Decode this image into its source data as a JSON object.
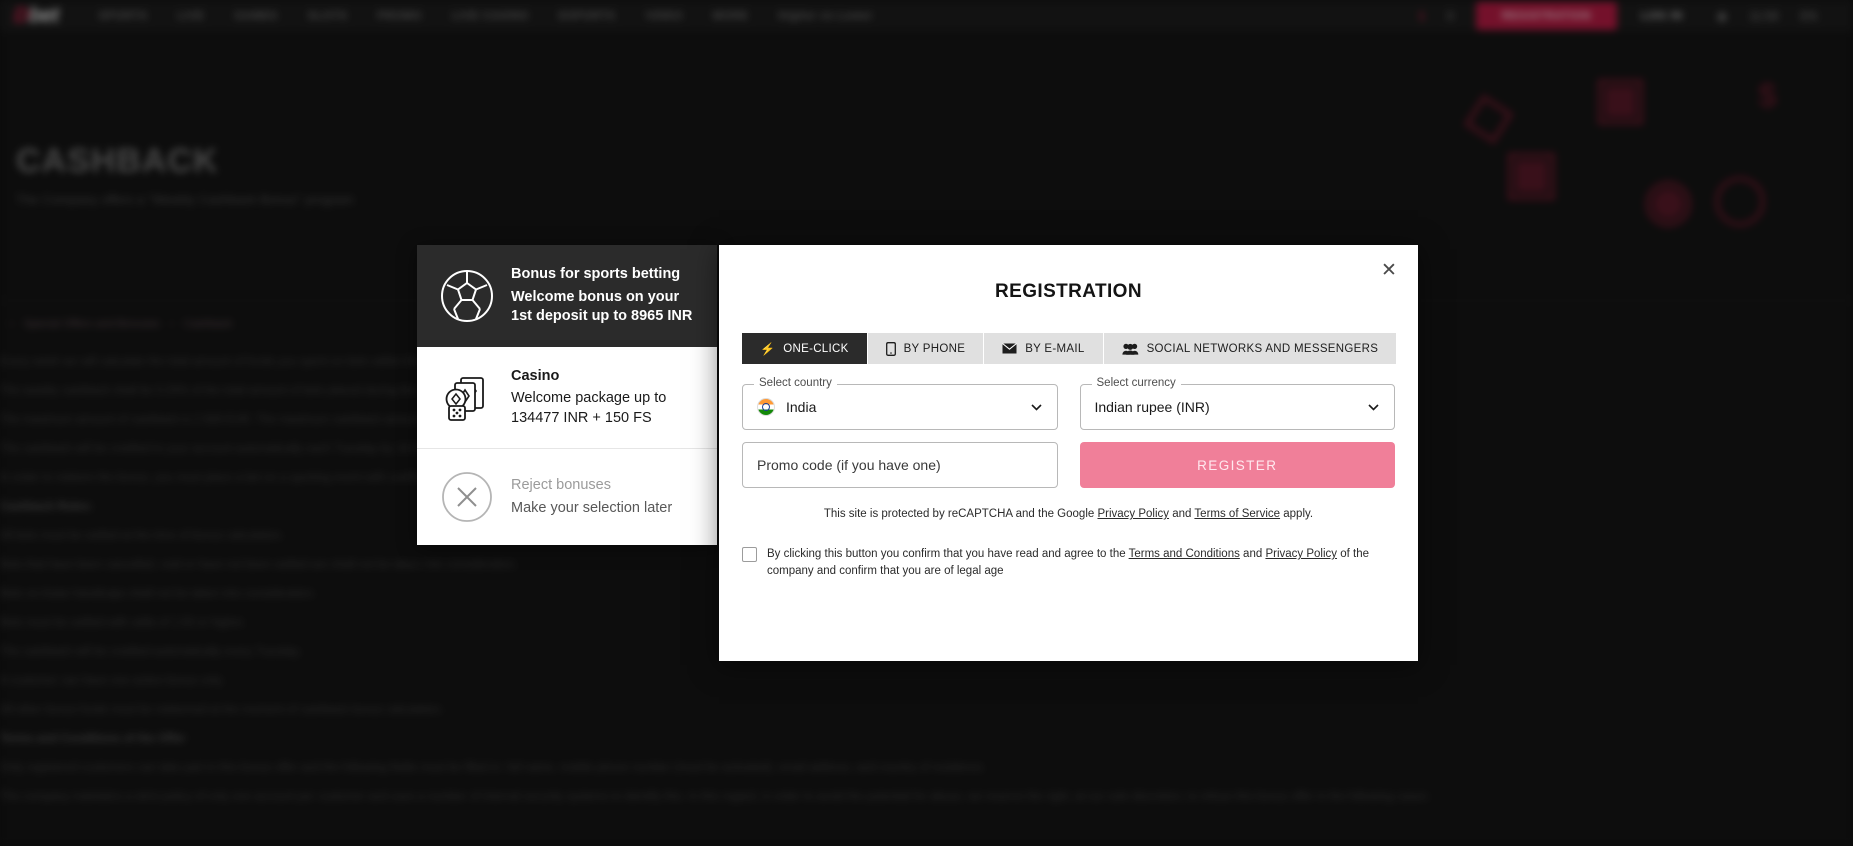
{
  "header": {
    "logo_text": "bet",
    "logo_prefix": "D",
    "nav": [
      {
        "label": "SPORTS"
      },
      {
        "label": "LIVE"
      },
      {
        "label": "GAMES"
      },
      {
        "label": "SLOTS"
      },
      {
        "label": "PROMO"
      },
      {
        "label": "LIVE CASINO"
      },
      {
        "label": "ESPORTS"
      },
      {
        "label": "VIDEO"
      },
      {
        "label": "MORE"
      }
    ],
    "higher_lower_label": "Higher vs Lower",
    "notifications_count": "1",
    "gift_badge": "0",
    "register_label": "REGISTRATION",
    "login_label": "LOG IN",
    "language_label": "EN",
    "time_label": "11:59"
  },
  "hero": {
    "title": "CASHBACK",
    "subtitle": "The Company offers a \"Weekly Cashback Bonus\" program"
  },
  "breadcrumb": {
    "root": "Special Offers and Bonuses",
    "current": "Cashback"
  },
  "page_body": {
    "lines": [
      "Every week we will calculate the total amount of funds you spent on bets within the calendar week.",
      "The weekly cashback shall be 0.25% of the total amount of bets placed during the week.",
      "The maximum amount of cashback is 2 928 EUR. The maximum cashback amount depends on your status.",
      "The cashback will be credited to your account automatically each Tuesday by 18:00 (GMT+3).",
      "In order to redeem the bonus, you must place a bet on a sporting event with coefficients not lower than 1.50.",
      "Cashback Rules:",
      "All bets must be settled at the time of bonus calculation.",
      "Bets that have been cancelled, void or have not been settled are shall not be taken into consideration.",
      "Bets on Asian handicaps shall not be taken into consideration.",
      "Bets must be settled with odds of 1.50 or higher.",
      "The cashback will be credited automatically every Tuesday.",
      "A customer can have one active bonus only.",
      "All other bonus funds must be redeemed at the moment of cashback bonus calculation.",
      "Terms and Conditions of the Offer",
      "Only registered customers can take part in this bonus offer and the following fields must be filled in: full name, mobile phone number (must be activated), email address, and country of residence.",
      "The company maintains a strict policy of only one account per customer and uses a number of internal security systems to identify this. In this regard, in order to avoid the potential for abuse, we reserve the right, at our sole discretion, to refuse this bonus offer in the following cases:"
    ]
  },
  "bonus_panel": {
    "options": [
      {
        "icon": "football-icon",
        "title": "Bonus for sports betting",
        "description": "Welcome bonus on your 1st deposit up to 8965 INR",
        "selected": true
      },
      {
        "icon": "casino-chips-icon",
        "title": "Casino",
        "description": "Welcome package up to 134477 INR + 150 FS",
        "selected": false
      },
      {
        "icon": "reject-circle-x-icon",
        "title": "Reject bonuses",
        "description": "Make your selection later",
        "selected": false
      }
    ]
  },
  "modal": {
    "title": "REGISTRATION",
    "close_label": "✕",
    "tabs": [
      {
        "label": "ONE-CLICK",
        "icon": "lightning-icon",
        "active": true
      },
      {
        "label": "BY PHONE",
        "icon": "phone-icon",
        "active": false
      },
      {
        "label": "BY E-MAIL",
        "icon": "envelope-icon",
        "active": false
      },
      {
        "label": "SOCIAL NETWORKS AND MESSENGERS",
        "icon": "people-icon",
        "active": false
      }
    ],
    "country": {
      "legend": "Select country",
      "value": "India",
      "flag": "india-flag-icon"
    },
    "currency": {
      "legend": "Select currency",
      "value": "Indian rupee (INR)"
    },
    "promo": {
      "placeholder": "Promo code (if you have one)",
      "value": ""
    },
    "register_button": "REGISTER",
    "recaptcha": {
      "prefix": "This site is protected by reCAPTCHA and the Google ",
      "link1": "Privacy Policy",
      "middle": " and ",
      "link2": "Terms of Service",
      "suffix": " apply."
    },
    "terms": {
      "prefix": "By clicking this button you confirm that you have read and agree to the ",
      "link1": "Terms and Conditions",
      "middle": " and ",
      "link2": "Privacy Policy",
      "suffix": " of the company and confirm that you are of legal age",
      "checked": false
    }
  },
  "colors": {
    "accent_pink": "#f07f99",
    "brand_red": "#d8244f",
    "dark": "#2b2b2b"
  }
}
